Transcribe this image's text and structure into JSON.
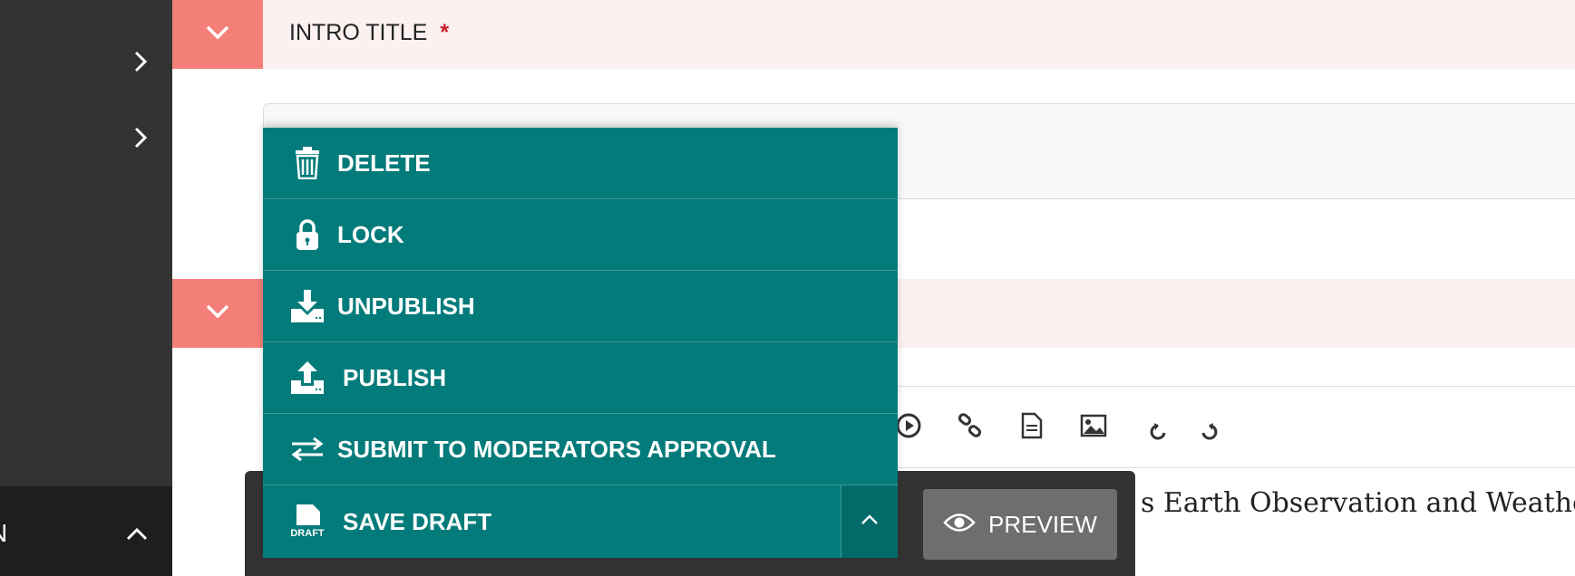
{
  "sections": [
    {
      "title": "INTRO TITLE",
      "required_mark": "*"
    },
    {
      "title": "",
      "required_mark": ""
    }
  ],
  "sidebar": {
    "footer_text": "N",
    "items": [
      {
        "icon": "chevron-right-icon"
      },
      {
        "icon": "chevron-right-icon"
      }
    ]
  },
  "editor": {
    "content_visible": "s Earth Observation and Weathe",
    "toolbar_icons": [
      "play-circle-icon",
      "link-icon",
      "document-icon",
      "image-icon",
      "undo-icon",
      "redo-icon"
    ]
  },
  "actions_menu": {
    "items": [
      {
        "label": "DELETE",
        "icon": "trash-icon"
      },
      {
        "label": "LOCK",
        "icon": "lock-icon"
      },
      {
        "label": "UNPUBLISH",
        "icon": "download-tray-icon"
      },
      {
        "label": "PUBLISH",
        "icon": "upload-tray-icon"
      },
      {
        "label": "SUBMIT TO MODERATORS APPROVAL",
        "icon": "swap-arrows-icon"
      }
    ],
    "save_draft": {
      "label": "SAVE DRAFT",
      "icon_text": "DRAFT"
    }
  },
  "preview_button": {
    "label": "PREVIEW",
    "icon": "eye-icon"
  },
  "colors": {
    "accent_teal": "#047b7b",
    "collapse_salmon": "#f47f78",
    "header_pink": "#fcf0f0",
    "sidebar_dark": "#333333",
    "required_red": "#c8202a"
  }
}
